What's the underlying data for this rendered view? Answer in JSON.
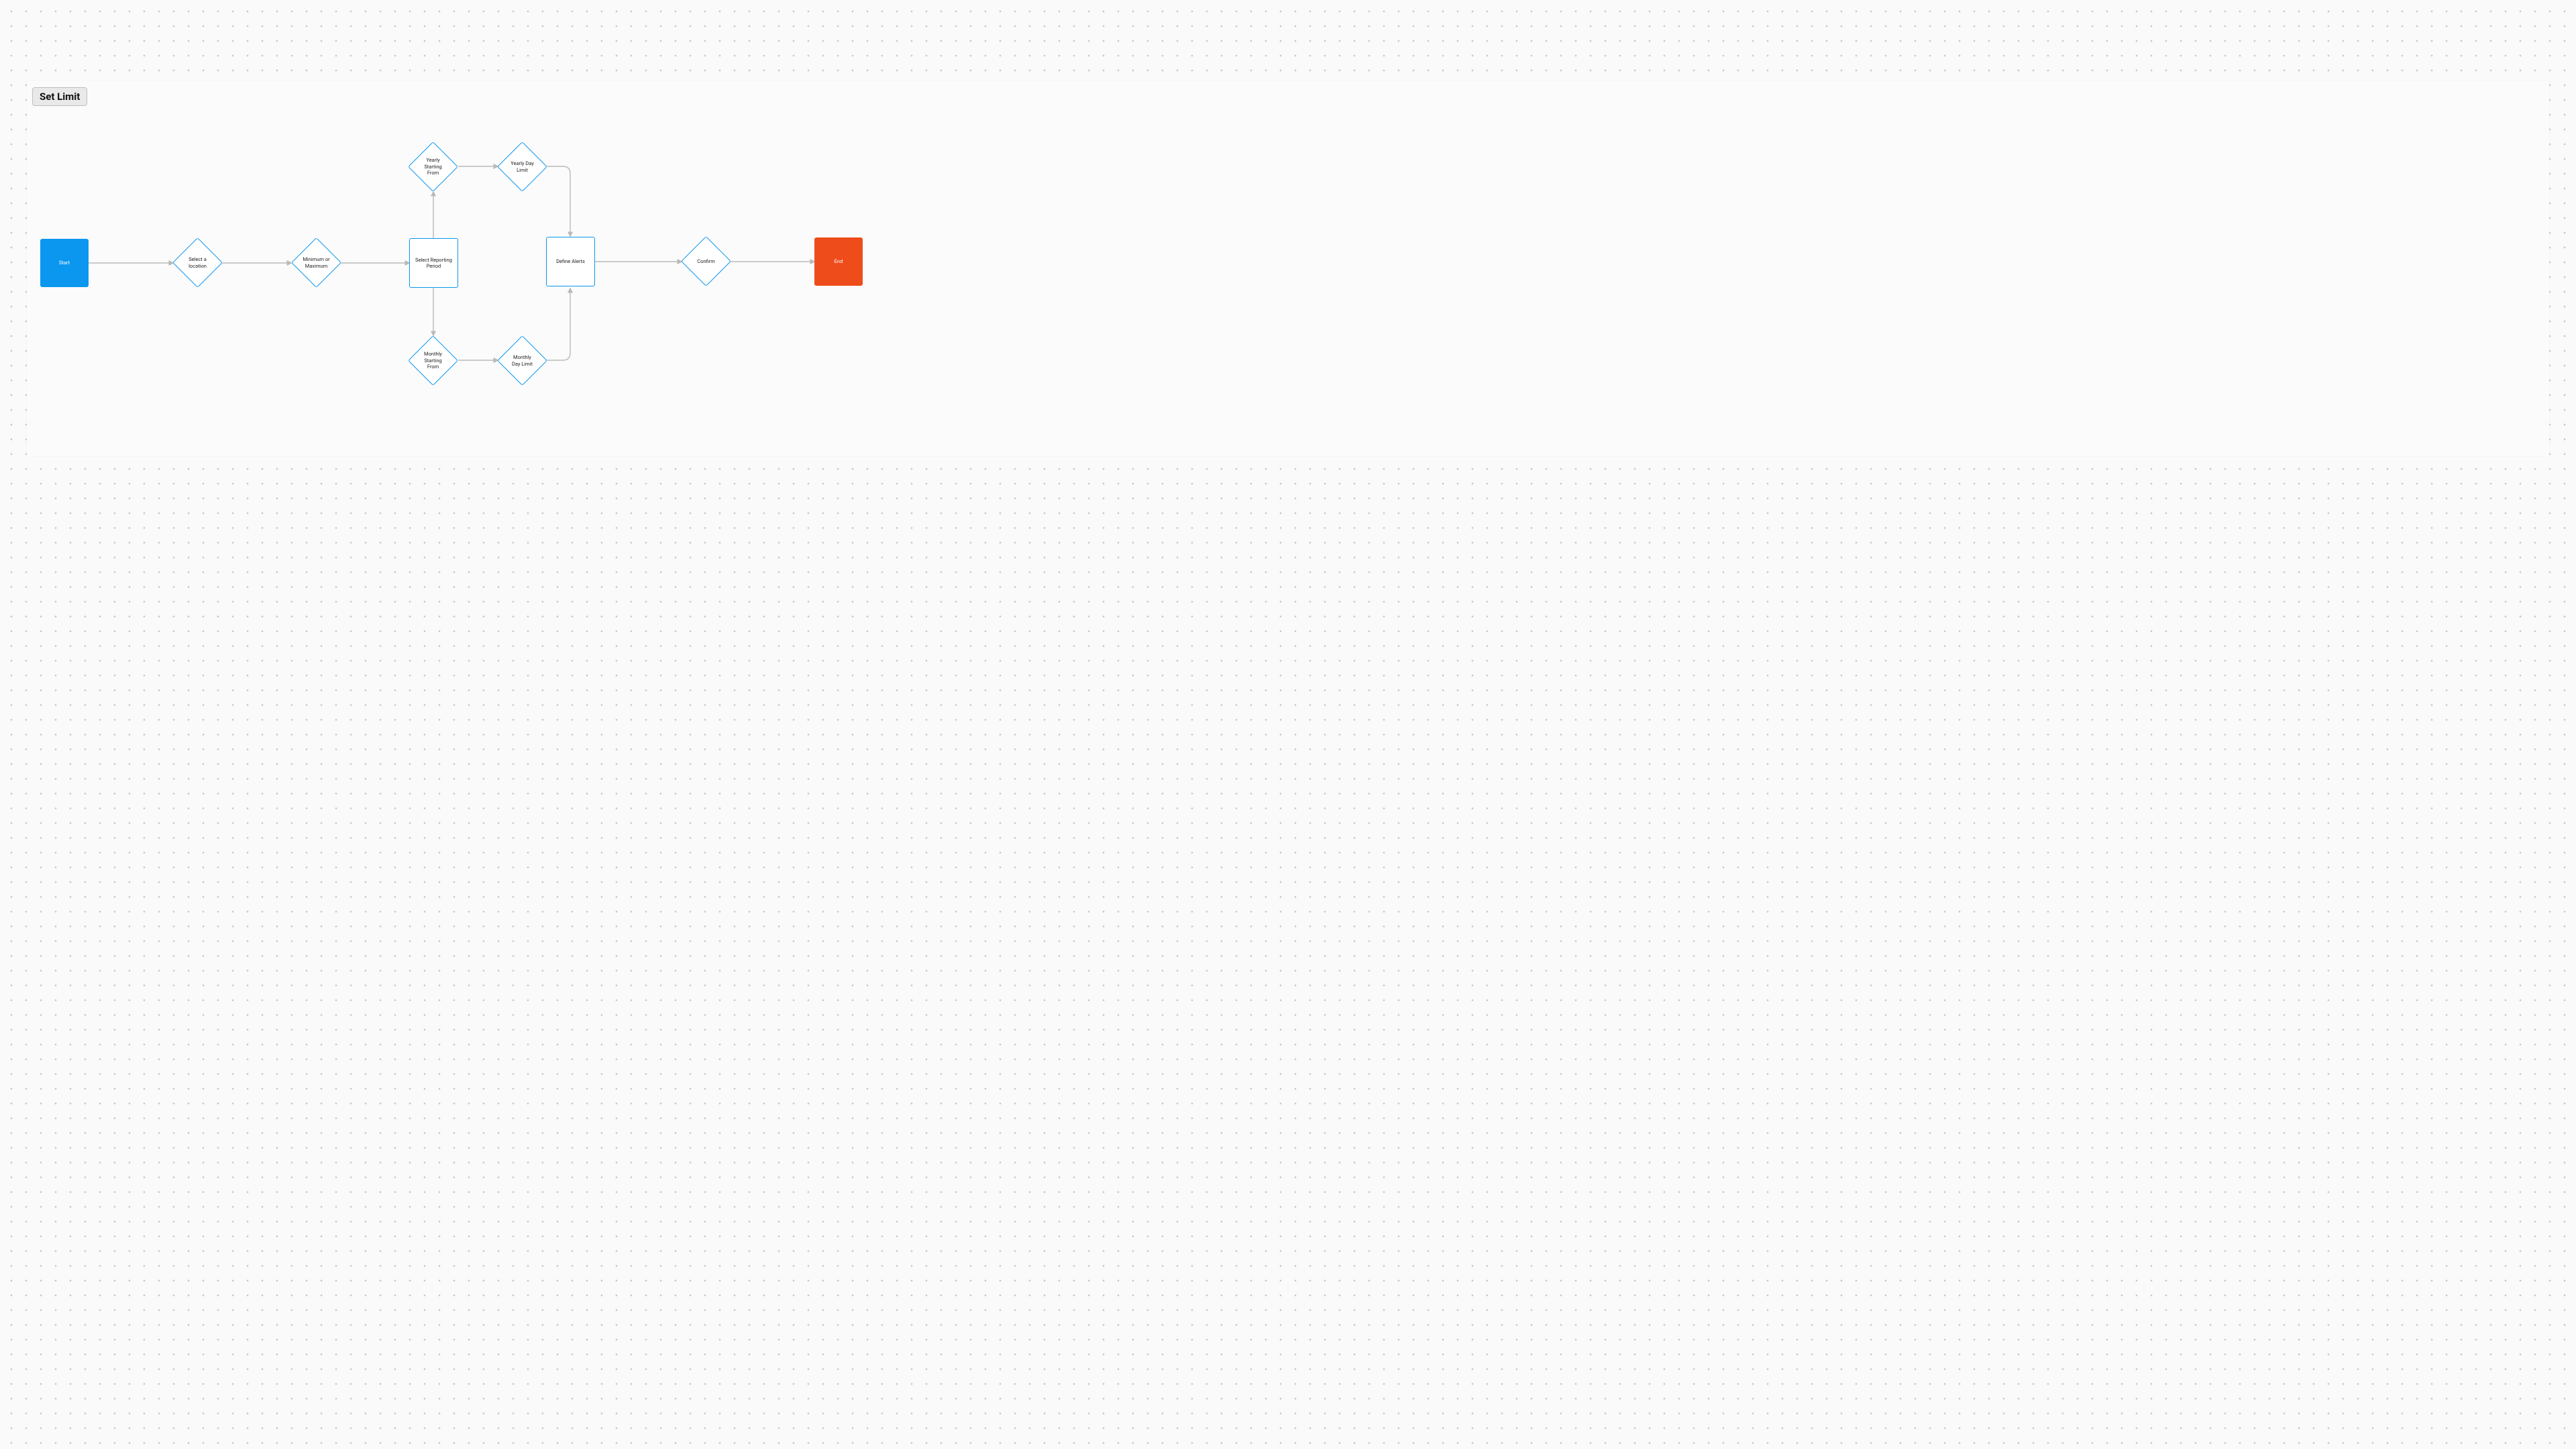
{
  "title": "Set Limit",
  "nodes": {
    "start": {
      "label": "Start"
    },
    "select_location": {
      "label": "Select a location"
    },
    "min_max": {
      "label": "Minimum or Maximum"
    },
    "reporting_period": {
      "label": "Select Reporting Period"
    },
    "yearly_from": {
      "label": "Yearly Starting From"
    },
    "yearly_limit": {
      "label": "Yearly Day Limit"
    },
    "monthly_from": {
      "label": "Monthly Starting From"
    },
    "monthly_limit": {
      "label": "Monthly Day Limit"
    },
    "define_alerts": {
      "label": "Define Alerts"
    },
    "confirm": {
      "label": "Confirm"
    },
    "end": {
      "label": "End"
    }
  }
}
